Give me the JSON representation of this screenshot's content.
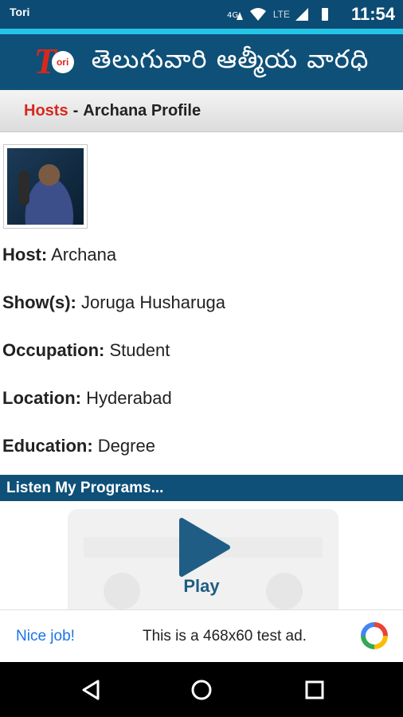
{
  "status_bar": {
    "app_badge": "Tori",
    "network": "4G",
    "lte": "LTE",
    "time": "11:54"
  },
  "header": {
    "logo_letter": "T",
    "logo_badge": "ori",
    "title": "తెలుగువారి ఆత్మీయ వారధి"
  },
  "breadcrumb": {
    "link": "Hosts",
    "separator": "-",
    "current": "Archana Profile"
  },
  "profile": {
    "fields": [
      {
        "key": "Host:",
        "value": "Archana"
      },
      {
        "key": "Show(s):",
        "value": "Joruga Husharuga"
      },
      {
        "key": "Occupation:",
        "value": "Student"
      },
      {
        "key": "Location:",
        "value": "Hyderabad"
      },
      {
        "key": "Education:",
        "value": "Degree"
      }
    ]
  },
  "programs": {
    "section_title": "Listen My Programs...",
    "play_label": "Play"
  },
  "ad": {
    "nice": "Nice job!",
    "text": "This is a 468x60 test ad."
  },
  "colors": {
    "brand_blue": "#0f5078",
    "accent_red": "#d8281e",
    "cyan": "#25c5e8"
  }
}
